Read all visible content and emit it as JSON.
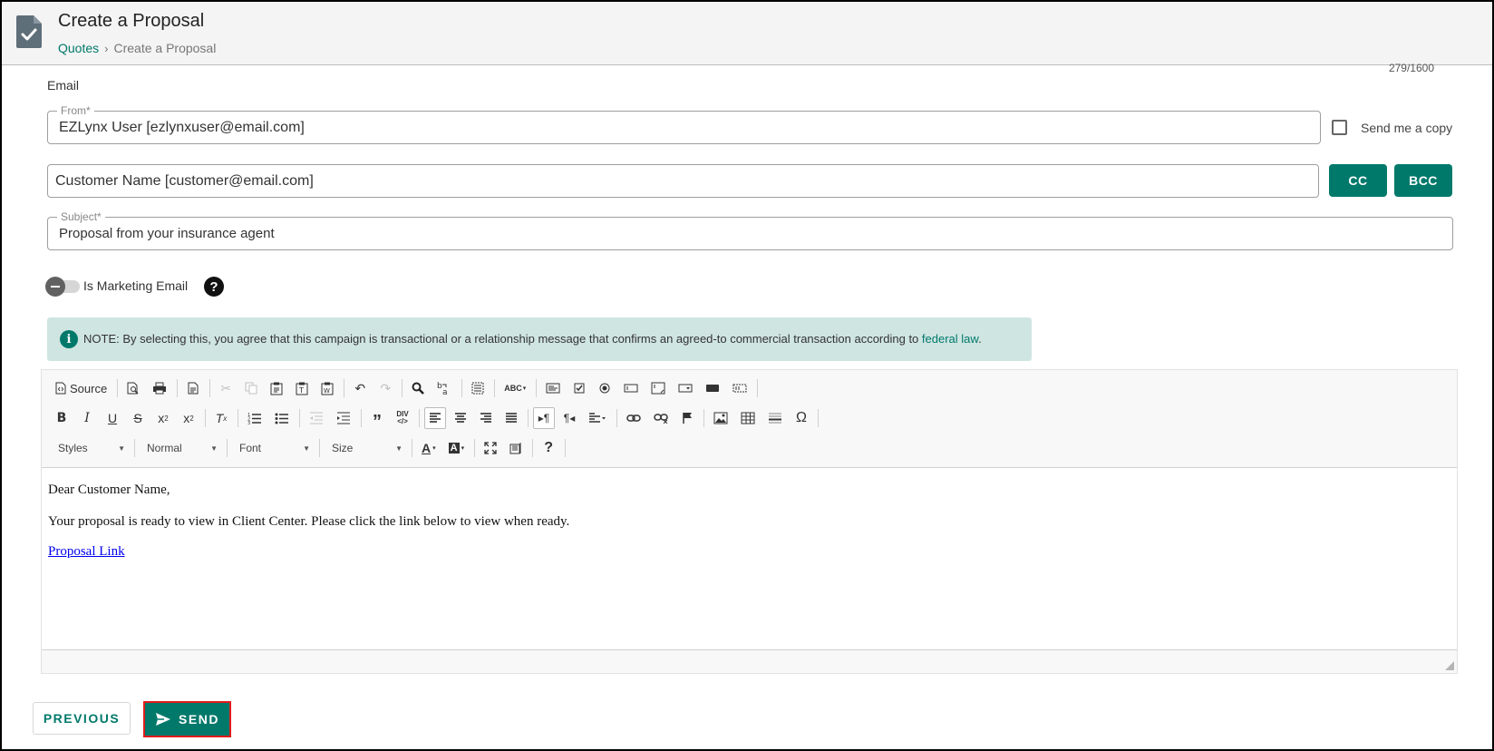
{
  "header": {
    "title": "Create a Proposal",
    "breadcrumb": {
      "link": "Quotes",
      "separator": "›",
      "current": "Create a Proposal"
    }
  },
  "char_count": "279/1600",
  "section_label": "Email",
  "from": {
    "legend": "From*",
    "value": "EZLynx User [ezlynxuser@email.com]"
  },
  "send_copy_label": "Send me a copy",
  "to": {
    "value": "Customer Name [customer@email.com]"
  },
  "cc_label": "CC",
  "bcc_label": "BCC",
  "subject": {
    "legend": "Subject*",
    "value": "Proposal from your insurance agent"
  },
  "marketing_label": "Is Marketing Email",
  "help_symbol": "?",
  "notice": {
    "text": "NOTE: By selecting this, you agree that this campaign is transactional or a relationship message that confirms an agreed-to commercial transaction according to ",
    "link": "federal law",
    "end": "."
  },
  "toolbar": {
    "source_label": "Source",
    "styles_label": "Styles",
    "format_label": "Normal",
    "font_label": "Font",
    "size_label": "Size",
    "help_symbol": "?"
  },
  "editor": {
    "greeting": "Dear Customer Name,",
    "body": "Your proposal is ready to view in Client Center. Please click the link below to view when ready.",
    "link": "Proposal Link"
  },
  "previous_label": "PREVIOUS",
  "send_label": "SEND",
  "colors": {
    "accent": "#00796b",
    "notice_bg": "#cfe5e2",
    "highlight": "#e01b1b"
  }
}
